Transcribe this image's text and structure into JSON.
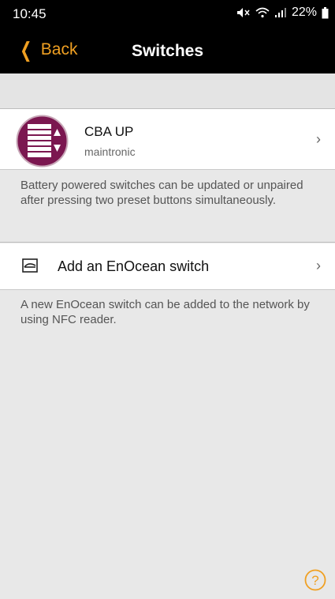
{
  "status_bar": {
    "time": "10:45",
    "battery": "22%",
    "icons": [
      "mute-icon",
      "wifi-icon",
      "signal-icon",
      "battery-icon"
    ]
  },
  "nav": {
    "back_label": "Back",
    "title": "Switches"
  },
  "device": {
    "name": "CBA UP",
    "manufacturer": "maintronic",
    "icon": "blind-switch-icon",
    "icon_color": "#7b1750"
  },
  "device_note": "Battery powered switches can be updated or unpaired after pressing two preset buttons simultaneously.",
  "add_switch": {
    "label": "Add an EnOcean switch",
    "icon": "switch-icon"
  },
  "add_note": "A new EnOcean switch can be added to the network by using NFC reader.",
  "help": {
    "icon": "help-icon"
  },
  "colors": {
    "accent": "#f0a022",
    "background": "#e8e8e8",
    "nav_background": "#000000"
  }
}
